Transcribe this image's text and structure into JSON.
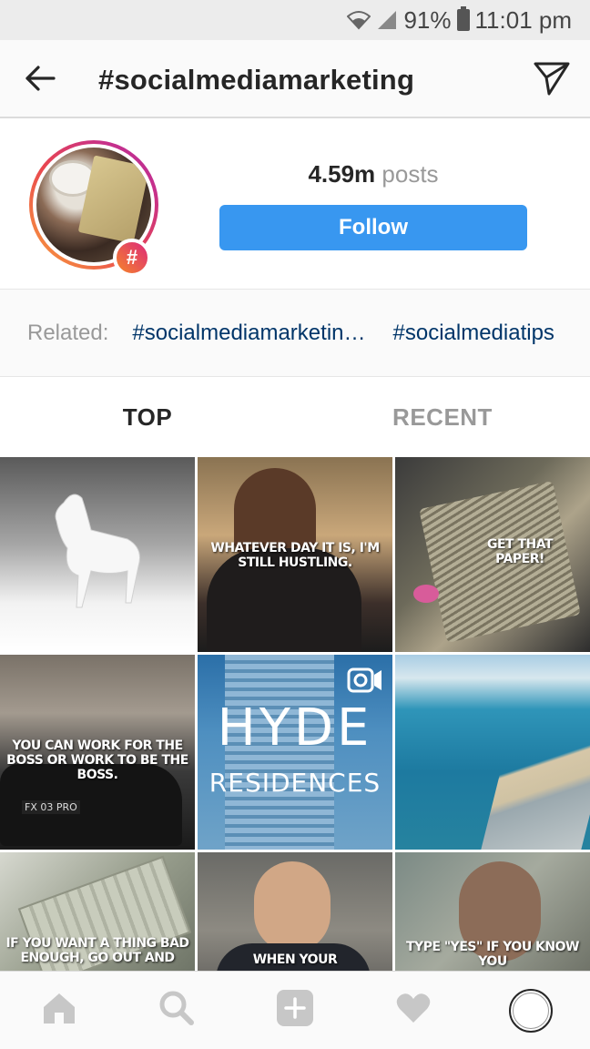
{
  "status_bar": {
    "battery": "91%",
    "time": "11:01 pm"
  },
  "header": {
    "title": "#socialmediamarketing",
    "back_icon": "back-arrow-icon",
    "direct_icon": "paper-plane-icon"
  },
  "profile": {
    "posts_count": "4.59m",
    "posts_label": "posts",
    "follow_label": "Follow",
    "badge_symbol": "#"
  },
  "related": {
    "label": "Related:",
    "tags": [
      "#socialmediamarketin…",
      "#socialmediatips"
    ]
  },
  "tabs": [
    {
      "label": "TOP",
      "active": true
    },
    {
      "label": "RECENT",
      "active": false
    }
  ],
  "grid": {
    "tiles": [
      {
        "caption": ""
      },
      {
        "caption": "WHATEVER DAY IT IS, I'M STILL HUSTLING."
      },
      {
        "caption": "GET THAT PAPER!"
      },
      {
        "caption": "YOU CAN WORK FOR THE BOSS OR WORK TO BE THE BOSS."
      },
      {
        "caption_line1": "HYDE",
        "caption_line2": "RESIDENCES"
      },
      {
        "caption": ""
      },
      {
        "caption": "IF YOU WANT A THING BAD ENOUGH, GO OUT AND"
      },
      {
        "caption": "WHEN YOUR"
      },
      {
        "caption": "TYPE \"YES\" IF YOU KNOW YOU"
      }
    ],
    "plate_text": "FX 03 PRO"
  },
  "bottom_nav": {
    "items": [
      "home-icon",
      "search-icon",
      "add-post-icon",
      "heart-icon",
      "profile-avatar"
    ]
  },
  "colors": {
    "follow_button": "#3897f0",
    "related_tag": "#003569",
    "muted_text": "#999999"
  }
}
